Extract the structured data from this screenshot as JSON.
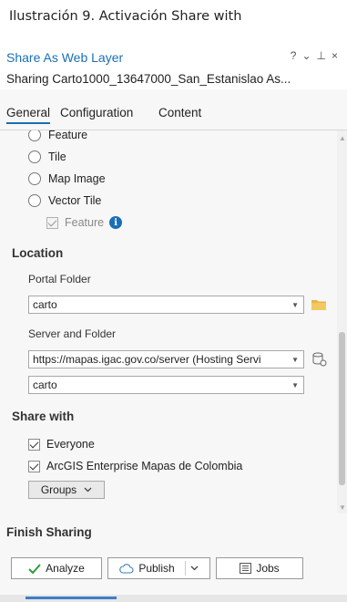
{
  "caption": "Ilustración 9. Activación Share with",
  "window": {
    "title": "Share As Web Layer",
    "icons": [
      "?",
      "⌄",
      "⊥",
      "×"
    ],
    "subtitle": "Sharing Carto1000_13647000_San_Estanislao As..."
  },
  "tabs": [
    {
      "label": "General",
      "active": true
    },
    {
      "label": "Configuration",
      "active": false
    },
    {
      "label": "Content",
      "active": false
    }
  ],
  "layer_types": [
    {
      "label": "Feature",
      "selected": false
    },
    {
      "label": "Tile",
      "selected": false
    },
    {
      "label": "Map Image",
      "selected": false
    },
    {
      "label": "Vector Tile",
      "selected": false
    }
  ],
  "sub_option": {
    "label": "Feature",
    "checked": true,
    "disabled": true
  },
  "location": {
    "heading": "Location",
    "portal_folder_label": "Portal Folder",
    "portal_folder_value": "carto",
    "server_folder_label": "Server and Folder",
    "server_value": "https://mapas.igac.gov.co/server (Hosting Servi",
    "folder_value": "carto"
  },
  "share_with": {
    "heading": "Share with",
    "options": [
      {
        "label": "Everyone",
        "checked": true
      },
      {
        "label": "ArcGIS Enterprise Mapas de Colombia",
        "checked": true
      }
    ],
    "groups_label": "Groups"
  },
  "finish": {
    "heading": "Finish Sharing",
    "analyze_label": "Analyze",
    "publish_label": "Publish",
    "jobs_label": "Jobs"
  },
  "colors": {
    "accent": "#1a6fb5",
    "analyze_check": "#2e9b3a",
    "folder": "#e8b54a"
  }
}
